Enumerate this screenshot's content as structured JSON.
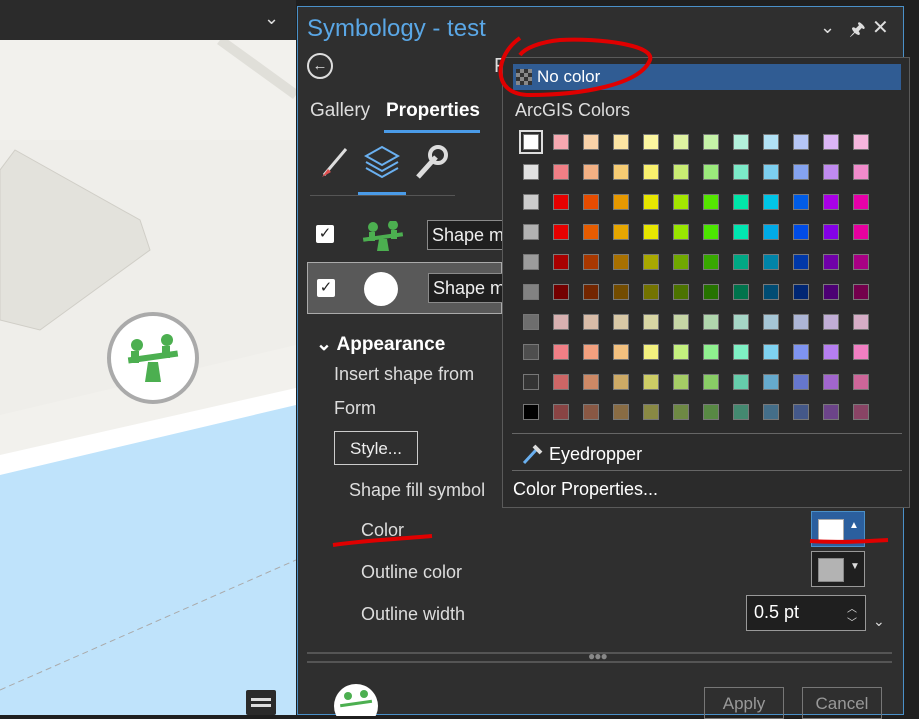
{
  "map": {
    "chevron": "⌄",
    "list_icon": "table-icon"
  },
  "pane": {
    "title": "Symbology - test",
    "controls": {
      "dropdown": "⌄",
      "pin": "🖈",
      "close": "✕"
    },
    "partial_heading": "F",
    "tabs": [
      {
        "label": "Gallery"
      },
      {
        "label": "Properties"
      }
    ],
    "icons": [
      "brush-icon",
      "layers-icon",
      "wrench-icon"
    ],
    "layers": [
      {
        "checked": true,
        "shape_label": "Shape ma",
        "icon": "seesaw-icon"
      },
      {
        "checked": true,
        "shape_label": "Shape ma",
        "icon": "circle-icon"
      }
    ],
    "appearance": {
      "heading": "Appearance",
      "insert_shape": "Insert shape from",
      "form": "Form",
      "style_button": "Style...",
      "shape_fill": "Shape fill symbol",
      "color": "Color",
      "outline_color": "Outline color",
      "outline_width": "Outline width",
      "outline_width_value": "0.5 pt"
    },
    "buttons": {
      "apply": "Apply",
      "cancel": "Cancel"
    }
  },
  "popup": {
    "no_color": "No color",
    "section": "ArcGIS Colors",
    "eyedropper": "Eyedropper",
    "color_properties": "Color Properties...",
    "selected_color": "#ffffff",
    "palette": [
      [
        "#ffffff",
        "#f5a8b0",
        "#f8d2a9",
        "#fbe4a3",
        "#fbf6a0",
        "#dff2a2",
        "#c5f2a8",
        "#b3f1dc",
        "#b2e2f5",
        "#b6c6f5",
        "#dcb6f5",
        "#f5b6dd"
      ],
      [
        "#e1e1e1",
        "#f07f86",
        "#f2b084",
        "#f6cc74",
        "#f8f06e",
        "#c9ec74",
        "#9bea7c",
        "#7ceac8",
        "#7dcfef",
        "#85a3ef",
        "#c08bef",
        "#f08bcb"
      ],
      [
        "#cccccc",
        "#e60000",
        "#e64c00",
        "#e69800",
        "#e6e600",
        "#a3e600",
        "#55e600",
        "#00e6a9",
        "#00c5e6",
        "#005ce6",
        "#a900e6",
        "#e600a9"
      ],
      [
        "#b2b2b2",
        "#e60000",
        "#e65c00",
        "#e6a600",
        "#e6e600",
        "#98e600",
        "#4ce600",
        "#00e6b0",
        "#00aae6",
        "#004ce6",
        "#8400e6",
        "#e6009f"
      ],
      [
        "#9c9c9c",
        "#a80000",
        "#a83800",
        "#a87000",
        "#a8a800",
        "#70a800",
        "#38a800",
        "#00a884",
        "#0084a8",
        "#0038a8",
        "#7000a8",
        "#a80084"
      ],
      [
        "#828282",
        "#730000",
        "#732600",
        "#734c00",
        "#737300",
        "#4c7300",
        "#267300",
        "#00734c",
        "#004c73",
        "#002673",
        "#4c0073",
        "#73004c"
      ],
      [
        "#6e6e6e",
        "#d7b0b0",
        "#d8bca8",
        "#d8c8a6",
        "#d8d6a4",
        "#c6d6a6",
        "#b0d6ad",
        "#a6d6c6",
        "#a6c6d6",
        "#adb6d6",
        "#c1aed6",
        "#d6adc6"
      ],
      [
        "#4e4e4e",
        "#f07f86",
        "#f2a07f",
        "#f2c07f",
        "#f2f07f",
        "#c4f07f",
        "#8ff08f",
        "#7ff0c4",
        "#7fd2f0",
        "#7f94f0",
        "#b67ff0",
        "#f07fc2"
      ],
      [
        "#343434",
        "#cd6666",
        "#cd8966",
        "#cdaa66",
        "#cdcd66",
        "#a5cd66",
        "#89cd66",
        "#66cdab",
        "#66aacd",
        "#6677cd",
        "#a166cd",
        "#cd6699"
      ],
      [
        "#000000",
        "#894444",
        "#895844",
        "#896c44",
        "#898944",
        "#6e8944",
        "#588944",
        "#448970",
        "#446e89",
        "#445889",
        "#6c4489",
        "#894465"
      ]
    ]
  }
}
